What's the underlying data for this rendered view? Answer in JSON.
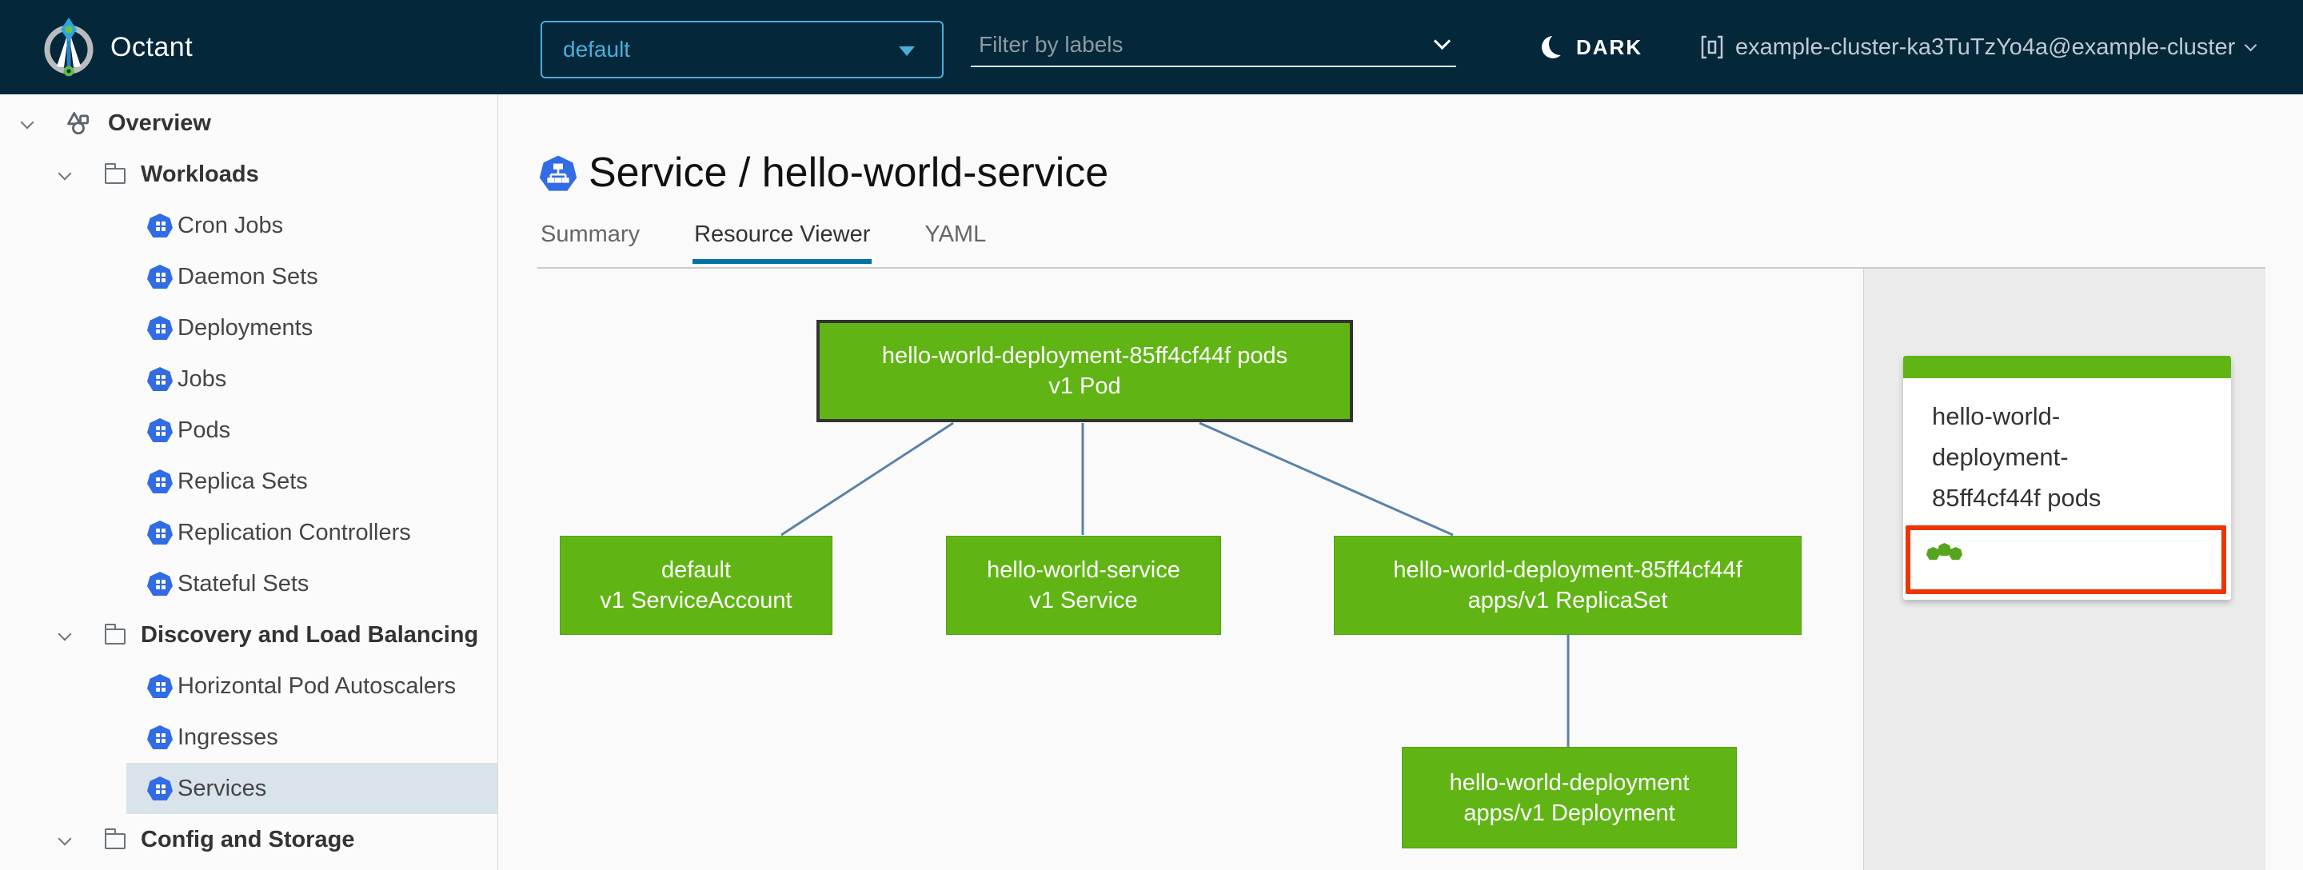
{
  "header": {
    "app_title": "Octant",
    "namespace_dropdown": {
      "value": "default"
    },
    "label_filter": {
      "placeholder": "Filter by labels"
    },
    "theme_toggle_label": "DARK",
    "context_selector": {
      "value": "example-cluster-ka3TuTzYo4a@example-cluster"
    }
  },
  "sidebar": {
    "items": [
      {
        "label": "Overview",
        "level": "root",
        "icon": "applications-icon",
        "expanded": true
      },
      {
        "label": "Workloads",
        "level": "section",
        "icon": "folder-icon",
        "expanded": true
      },
      {
        "label": "Cron Jobs",
        "level": "item",
        "icon": "cronjobs-icon"
      },
      {
        "label": "Daemon Sets",
        "level": "item",
        "icon": "daemonsets-icon"
      },
      {
        "label": "Deployments",
        "level": "item",
        "icon": "deployments-icon"
      },
      {
        "label": "Jobs",
        "level": "item",
        "icon": "jobs-icon"
      },
      {
        "label": "Pods",
        "level": "item",
        "icon": "pods-icon"
      },
      {
        "label": "Replica Sets",
        "level": "item",
        "icon": "replicasets-icon"
      },
      {
        "label": "Replication Controllers",
        "level": "item",
        "icon": "replicationcontrollers-icon"
      },
      {
        "label": "Stateful Sets",
        "level": "item",
        "icon": "statefulsets-icon"
      },
      {
        "label": "Discovery and Load Balancing",
        "level": "section",
        "icon": "folder-icon",
        "expanded": true
      },
      {
        "label": "Horizontal Pod Autoscalers",
        "level": "item",
        "icon": "horizontalpodautoscalers-icon"
      },
      {
        "label": "Ingresses",
        "level": "item",
        "icon": "ingresses-icon"
      },
      {
        "label": "Services",
        "level": "item",
        "icon": "services-icon",
        "selected": true
      },
      {
        "label": "Config and Storage",
        "level": "section",
        "icon": "folder-icon",
        "expanded": true
      }
    ]
  },
  "main": {
    "title": "Service / hello-world-service",
    "tabs": [
      {
        "label": "Summary",
        "active": false
      },
      {
        "label": "Resource Viewer",
        "active": true
      },
      {
        "label": "YAML",
        "active": false
      }
    ]
  },
  "graph": {
    "nodes": {
      "pod": {
        "line1": "hello-world-deployment-85ff4cf44f pods",
        "line2": "v1 Pod",
        "selected": true
      },
      "serviceaccount": {
        "line1": "default",
        "line2": "v1 ServiceAccount"
      },
      "service": {
        "line1": "hello-world-service",
        "line2": "v1 Service"
      },
      "replicaset": {
        "line1": "hello-world-deployment-85ff4cf44f",
        "line2": "apps/v1 ReplicaSet"
      },
      "deployment": {
        "line1": "hello-world-deployment",
        "line2": "apps/v1 Deployment"
      }
    }
  },
  "minimap": {
    "selected_node_label": "hello-world-deployment-85ff4cf44f pods",
    "pod_count": 3
  },
  "colors": {
    "header_bg": "#04273a",
    "accent_blue": "#49afd9",
    "k8s_blue": "#326ce5",
    "node_green": "#60b515",
    "status_green": "#55a51e",
    "selection_red": "#ee3400",
    "edge_blue": "#5b82a8",
    "tab_active_underline": "#0072a3",
    "sidebar_highlight": "#d8e3ea"
  }
}
